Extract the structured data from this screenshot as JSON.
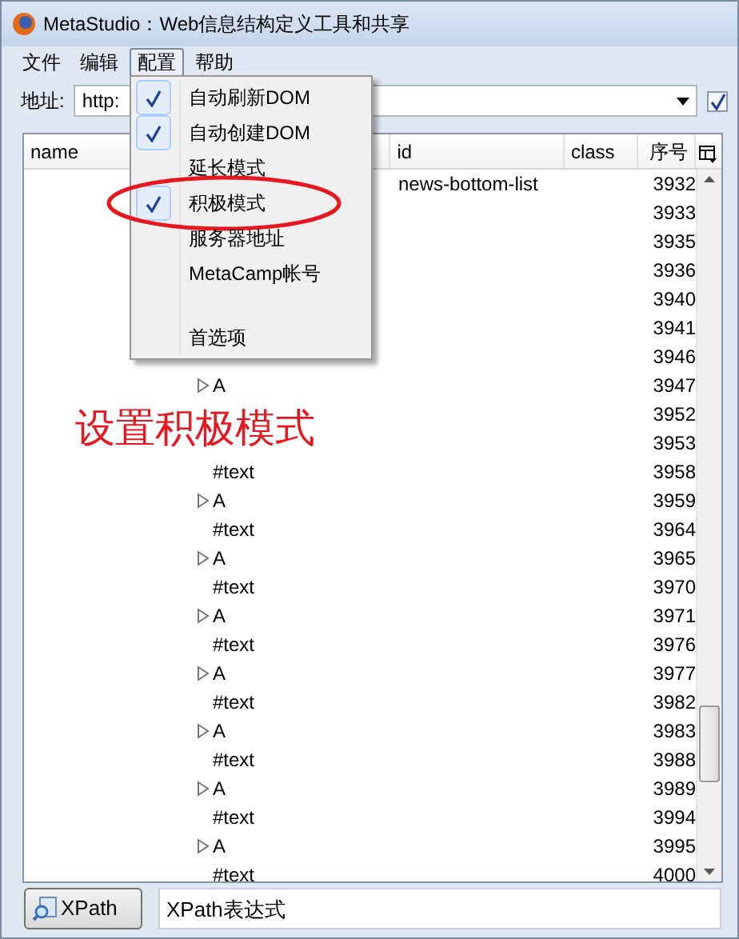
{
  "window": {
    "title": "MetaStudio：Web信息结构定义工具和共享"
  },
  "menu_bar": [
    {
      "label": "文件",
      "selected": false
    },
    {
      "label": "编辑",
      "selected": false
    },
    {
      "label": "配置",
      "selected": true
    },
    {
      "label": "帮助",
      "selected": false
    }
  ],
  "address": {
    "label": "地址:",
    "value": "http:",
    "checkbox_checked": true
  },
  "config_menu": [
    {
      "label": "自动刷新DOM",
      "checked": true,
      "circled": false
    },
    {
      "label": "自动创建DOM",
      "checked": true,
      "circled": false
    },
    {
      "label": "延长模式",
      "checked": false,
      "circled": false
    },
    {
      "label": "积极模式",
      "checked": true,
      "circled": true
    },
    {
      "label": "服务器地址",
      "checked": false,
      "circled": false
    },
    {
      "label": "MetaCamp帐号",
      "checked": false,
      "circled": false
    },
    {
      "label": "首选项",
      "checked": false,
      "circled": false
    }
  ],
  "annotation": {
    "text": "设置积极模式"
  },
  "table": {
    "columns": [
      "name",
      "id",
      "class",
      "序号"
    ],
    "rows": [
      {
        "id": "news-bottom-list",
        "seq": "3932"
      },
      {
        "seq": "3933"
      },
      {
        "seq": "3935"
      },
      {
        "seq": "3936"
      },
      {
        "seq": "3940"
      },
      {
        "seq": "3941"
      },
      {
        "seq": "3946"
      },
      {
        "name": "A",
        "expandable": true,
        "seq": "3947"
      },
      {
        "seq": "3952"
      },
      {
        "seq": "3953"
      },
      {
        "name": "#text",
        "expandable": false,
        "seq": "3958"
      },
      {
        "name": "A",
        "expandable": true,
        "seq": "3959"
      },
      {
        "name": "#text",
        "expandable": false,
        "seq": "3964"
      },
      {
        "name": "A",
        "expandable": true,
        "seq": "3965"
      },
      {
        "name": "#text",
        "expandable": false,
        "seq": "3970"
      },
      {
        "name": "A",
        "expandable": true,
        "seq": "3971"
      },
      {
        "name": "#text",
        "expandable": false,
        "seq": "3976"
      },
      {
        "name": "A",
        "expandable": true,
        "seq": "3977"
      },
      {
        "name": "#text",
        "expandable": false,
        "seq": "3982"
      },
      {
        "name": "A",
        "expandable": true,
        "seq": "3983"
      },
      {
        "name": "#text",
        "expandable": false,
        "seq": "3988"
      },
      {
        "name": "A",
        "expandable": true,
        "seq": "3989"
      },
      {
        "name": "#text",
        "expandable": false,
        "seq": "3994"
      },
      {
        "name": "A",
        "expandable": true,
        "seq": "3995"
      },
      {
        "name": "#text",
        "expandable": false,
        "seq": "4000"
      }
    ]
  },
  "bottom_bar": {
    "button": "XPath",
    "field_placeholder": "XPath表达式"
  }
}
